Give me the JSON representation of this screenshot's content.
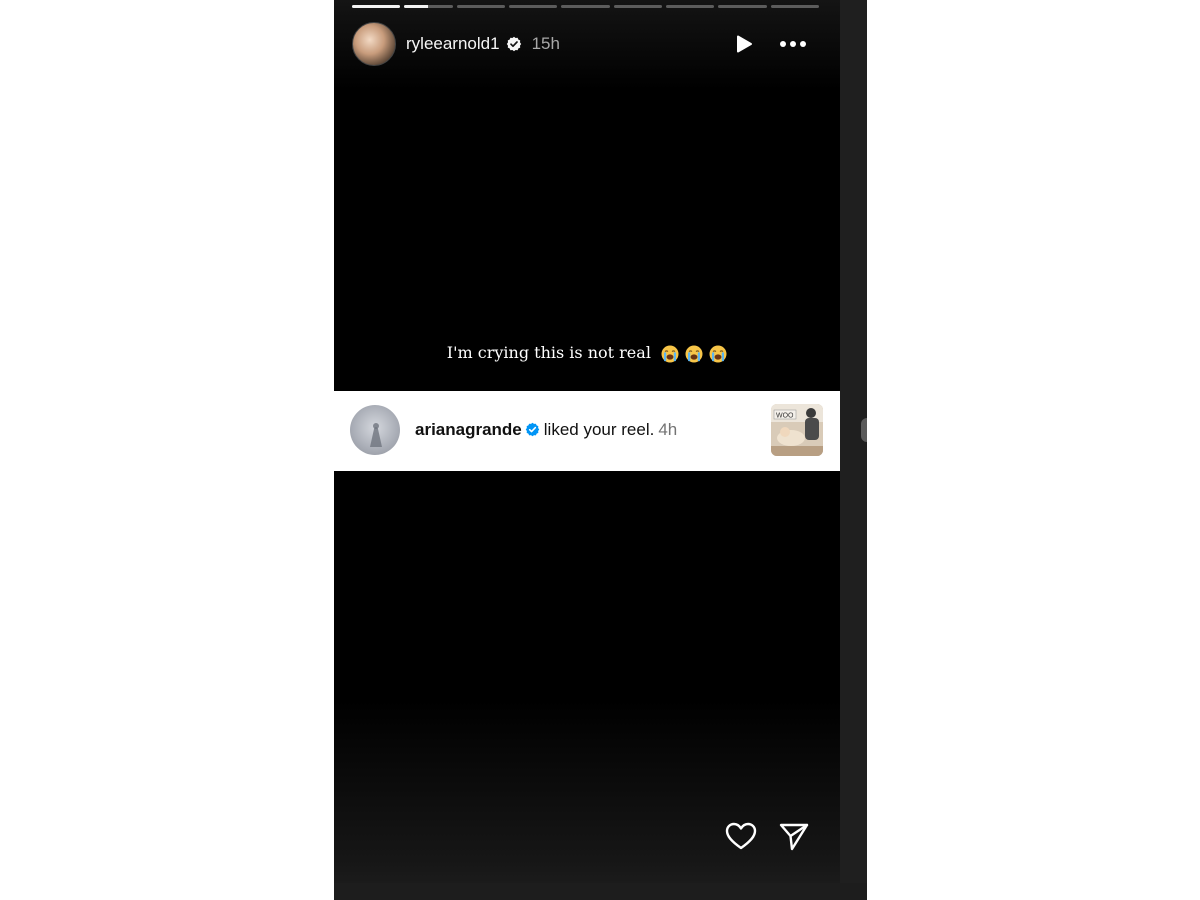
{
  "story": {
    "progress": {
      "segments": 9,
      "filled_segments": 1,
      "current_segment_progress": 0.5
    },
    "header": {
      "username": "ryleearnold1",
      "time": "15h",
      "verified_icon": "verified-badge-icon",
      "play_icon": "play-icon",
      "more_icon": "more-options-icon"
    },
    "caption": {
      "text": "I'm crying this is not real",
      "emojis": [
        "loudly-crying-face",
        "loudly-crying-face",
        "loudly-crying-face"
      ]
    },
    "notification": {
      "username": "arianagrande",
      "action": "liked your reel.",
      "time": "4h",
      "verified_color": "#0095f6",
      "thumb_label": "WOO"
    },
    "footer": {
      "like_icon": "heart-icon",
      "share_icon": "send-icon"
    }
  }
}
